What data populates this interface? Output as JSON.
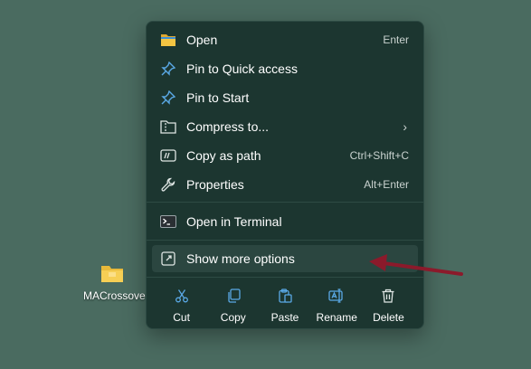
{
  "desktop": {
    "icon_label": "MACrossove"
  },
  "menu": {
    "items": [
      {
        "label": "Open",
        "shortcut": "Enter"
      },
      {
        "label": "Pin to Quick access",
        "shortcut": ""
      },
      {
        "label": "Pin to Start",
        "shortcut": ""
      },
      {
        "label": "Compress to...",
        "shortcut": ""
      },
      {
        "label": "Copy as path",
        "shortcut": "Ctrl+Shift+C"
      },
      {
        "label": "Properties",
        "shortcut": "Alt+Enter"
      },
      {
        "label": "Open in Terminal",
        "shortcut": ""
      },
      {
        "label": "Show more options",
        "shortcut": ""
      }
    ],
    "actions": [
      {
        "label": "Cut"
      },
      {
        "label": "Copy"
      },
      {
        "label": "Paste"
      },
      {
        "label": "Rename"
      },
      {
        "label": "Delete"
      }
    ]
  },
  "colors": {
    "desktop_bg": "#4a6b60",
    "menu_bg": "#1c3630",
    "highlight": "#2b4640",
    "accent_blue": "#5aa9e6",
    "folder_yellow": "#f4c542",
    "annotation_arrow": "#8b1a2b"
  }
}
